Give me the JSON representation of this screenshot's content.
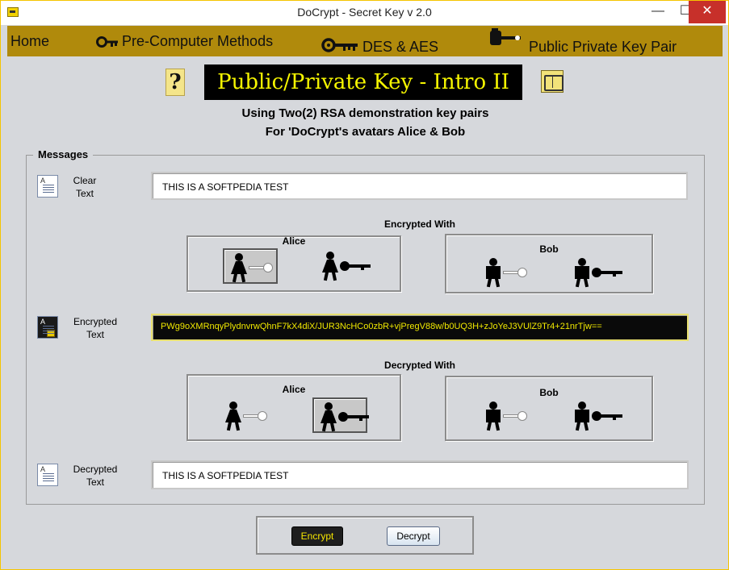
{
  "window": {
    "title": "DoCrypt - Secret Key v 2.0",
    "controls": {
      "minimize": "—",
      "maximize": "☐",
      "close": "✕"
    }
  },
  "nav": {
    "items": [
      {
        "label": "Home",
        "icon": ""
      },
      {
        "label": "Pre-Computer Methods",
        "icon": "key-icon"
      },
      {
        "label": "DES & AES",
        "icon": "key-icon"
      },
      {
        "label": "Public Private Key Pair",
        "icon": "key-icon"
      }
    ],
    "colors": {
      "bar": "#b08a0c"
    }
  },
  "header": {
    "help_icon": "?",
    "title": "Public/Private Key - Intro II",
    "subtitle_line1": "Using Two(2) RSA demonstration key pairs",
    "subtitle_line2": "For 'DoCrypt's avatars Alice & Bob",
    "colors": {
      "title_bg": "#000000",
      "title_fg": "#f6f600"
    }
  },
  "messages": {
    "legend": "Messages",
    "clear": {
      "label_line1": "Clear",
      "label_line2": "Text",
      "value": "THIS IS A SOFTPEDIA TEST"
    },
    "encrypted_with": {
      "title": "Encrypted With",
      "alice": "Alice",
      "bob": "Bob",
      "selected": "alice-public-key"
    },
    "encrypted": {
      "label_line1": "Encrypted",
      "label_line2": "Text",
      "value": "PWg9oXMRnqyPlydnvrwQhnF7kX4diX/JUR3NcHCo0zbR+vjPregV88w/b0UQ3H+zJoYeJ3VUlZ9Tr4+21nrTjw=="
    },
    "decrypted_with": {
      "title": "Decrypted With",
      "alice": "Alice",
      "bob": "Bob",
      "selected": "alice-private-key"
    },
    "decrypted": {
      "label_line1": "Decrypted",
      "label_line2": "Text",
      "value": "THIS IS A SOFTPEDIA TEST"
    }
  },
  "actions": {
    "encrypt": "Encrypt",
    "decrypt": "Decrypt",
    "colors": {
      "encrypt_bg": "#1e1e1e",
      "encrypt_fg": "#f5e600"
    }
  }
}
